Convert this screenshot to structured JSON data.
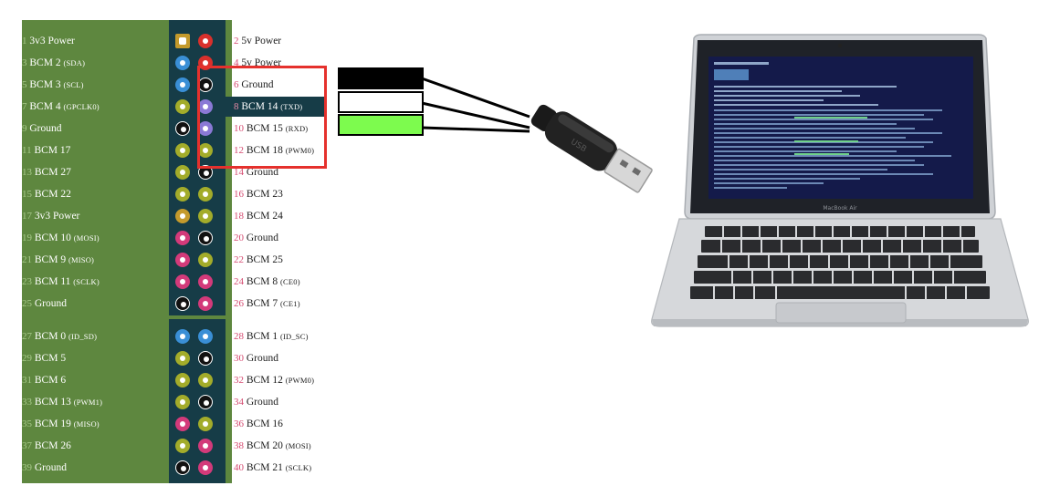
{
  "colors": {
    "board_green": "#5e873f",
    "strip_dark": "#163c47",
    "highlight_red": "#e5312d",
    "wire_black": "#000000",
    "wire_white": "#ffffff",
    "wire_green": "#7dfb4e",
    "pin_power_33": "#c49a2c",
    "pin_power_5v": "#d9302c",
    "pin_gpio": "#a3ac2a",
    "pin_i2c": "#3a8fd6",
    "pin_spi": "#d33a7a",
    "pin_uart": "#8a79d6",
    "pin_ground": "#111111"
  },
  "left_pins": [
    {
      "num": "1",
      "name": "3v3 Power",
      "small": ""
    },
    {
      "num": "3",
      "name": "BCM 2",
      "small": "(SDA)"
    },
    {
      "num": "5",
      "name": "BCM 3",
      "small": "(SCL)"
    },
    {
      "num": "7",
      "name": "BCM 4",
      "small": "(GPCLK0)"
    },
    {
      "num": "9",
      "name": "Ground",
      "small": ""
    },
    {
      "num": "11",
      "name": "BCM 17",
      "small": ""
    },
    {
      "num": "13",
      "name": "BCM 27",
      "small": ""
    },
    {
      "num": "15",
      "name": "BCM 22",
      "small": ""
    },
    {
      "num": "17",
      "name": "3v3 Power",
      "small": ""
    },
    {
      "num": "19",
      "name": "BCM 10",
      "small": "(MOSI)"
    },
    {
      "num": "21",
      "name": "BCM 9",
      "small": "(MISO)"
    },
    {
      "num": "23",
      "name": "BCM 11",
      "small": "(SCLK)"
    },
    {
      "num": "25",
      "name": "Ground",
      "small": ""
    },
    {
      "num": "27",
      "name": "BCM 0",
      "small": "(ID_SD)"
    },
    {
      "num": "29",
      "name": "BCM 5",
      "small": ""
    },
    {
      "num": "31",
      "name": "BCM 6",
      "small": ""
    },
    {
      "num": "33",
      "name": "BCM 13",
      "small": "(PWM1)"
    },
    {
      "num": "35",
      "name": "BCM 19",
      "small": "(MISO)"
    },
    {
      "num": "37",
      "name": "BCM 26",
      "small": ""
    },
    {
      "num": "39",
      "name": "Ground",
      "small": ""
    }
  ],
  "right_pins": [
    {
      "num": "2",
      "name": "5v Power",
      "small": ""
    },
    {
      "num": "4",
      "name": "5v Power",
      "small": ""
    },
    {
      "num": "6",
      "name": "Ground",
      "small": ""
    },
    {
      "num": "8",
      "name": "BCM 14",
      "small": "(TXD)"
    },
    {
      "num": "10",
      "name": "BCM 15",
      "small": "(RXD)"
    },
    {
      "num": "12",
      "name": "BCM 18",
      "small": "(PWM0)"
    },
    {
      "num": "14",
      "name": "Ground",
      "small": ""
    },
    {
      "num": "16",
      "name": "BCM 23",
      "small": ""
    },
    {
      "num": "18",
      "name": "BCM 24",
      "small": ""
    },
    {
      "num": "20",
      "name": "Ground",
      "small": ""
    },
    {
      "num": "22",
      "name": "BCM 25",
      "small": ""
    },
    {
      "num": "24",
      "name": "BCM 8",
      "small": "(CE0)"
    },
    {
      "num": "26",
      "name": "BCM 7",
      "small": "(CE1)"
    },
    {
      "num": "28",
      "name": "BCM 1",
      "small": "(ID_SC)"
    },
    {
      "num": "30",
      "name": "Ground",
      "small": ""
    },
    {
      "num": "32",
      "name": "BCM 12",
      "small": "(PWM0)"
    },
    {
      "num": "34",
      "name": "Ground",
      "small": ""
    },
    {
      "num": "36",
      "name": "BCM 16",
      "small": ""
    },
    {
      "num": "38",
      "name": "BCM 20",
      "small": "(MOSI)"
    },
    {
      "num": "40",
      "name": "BCM 21",
      "small": "(SCLK)"
    }
  ],
  "left_pin_types": [
    "power33",
    "i2c",
    "i2c",
    "gpio",
    "ground",
    "gpio",
    "gpio",
    "gpio",
    "power33",
    "spi",
    "spi",
    "spi",
    "ground",
    "i2c",
    "gpio",
    "gpio",
    "gpio",
    "spi",
    "gpio",
    "ground"
  ],
  "right_pin_types": [
    "power5",
    "power5",
    "ground",
    "uart",
    "uart",
    "gpio",
    "ground",
    "gpio",
    "gpio",
    "ground",
    "gpio",
    "spi",
    "spi",
    "i2c",
    "ground",
    "gpio",
    "ground",
    "gpio",
    "spi",
    "spi"
  ],
  "laptop": {
    "brand": "MacBook Air"
  }
}
